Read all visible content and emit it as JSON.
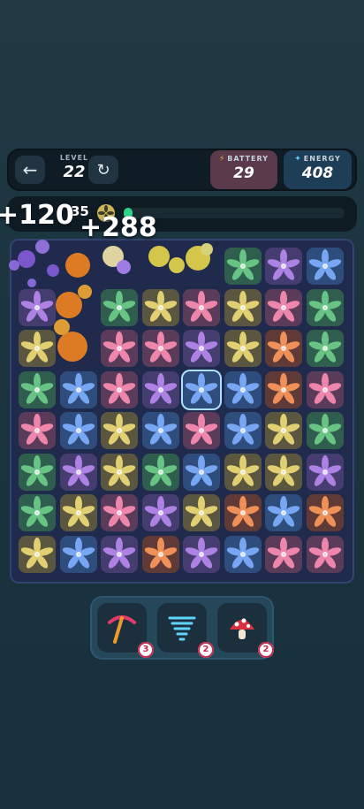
{
  "hud": {
    "level_label": "LEVEL",
    "level_value": "22",
    "battery_label": "BATTERY",
    "battery_value": "29",
    "energy_label": "ENERGY",
    "energy_value": "408"
  },
  "progress": {
    "moves": "35",
    "fill_fraction": 0.04
  },
  "score_popups": [
    "+120",
    "+288"
  ],
  "colors": {
    "green": "#2f5e4f",
    "purple": "#453c70",
    "blue": "#2e4c7c",
    "yellow": "#5a5640",
    "pink": "#5a3c5a",
    "orange": "#5f3a36"
  },
  "board": {
    "rows": [
      [
        "x",
        "x",
        "x",
        "x",
        "x",
        "green",
        "purple",
        "blue"
      ],
      [
        "purple",
        "x",
        "green",
        "yellow",
        "pink",
        "yellow",
        "pink",
        "green"
      ],
      [
        "yellow",
        "x",
        "pink",
        "pink",
        "purple",
        "yellow",
        "orange",
        "green"
      ],
      [
        "green",
        "blue",
        "pink",
        "purple",
        "blue",
        "blue",
        "orange",
        "pink"
      ],
      [
        "pink",
        "blue",
        "yellow",
        "blue",
        "pink",
        "blue",
        "yellow",
        "green"
      ],
      [
        "green",
        "purple",
        "yellow",
        "green",
        "blue",
        "yellow",
        "yellow",
        "purple"
      ],
      [
        "green",
        "yellow",
        "pink",
        "purple",
        "yellow",
        "orange",
        "blue",
        "orange"
      ],
      [
        "yellow",
        "blue",
        "purple",
        "orange",
        "purple",
        "blue",
        "pink",
        "pink"
      ]
    ],
    "selected": [
      3,
      4
    ]
  },
  "boosters": [
    {
      "name": "pickaxe",
      "count": "3"
    },
    {
      "name": "tornado",
      "count": "2"
    },
    {
      "name": "mushroom",
      "count": "2"
    }
  ]
}
